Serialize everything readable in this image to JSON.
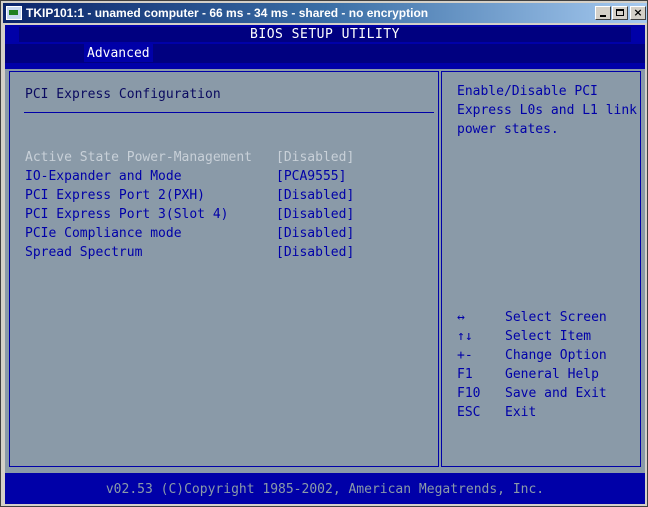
{
  "window": {
    "title": "TKIP101:1 - unamed computer - 66 ms - 34 ms - shared - no encryption",
    "buttons": {
      "minimize": "",
      "maximize": "",
      "close": "×"
    }
  },
  "bios": {
    "title": "BIOS SETUP UTILITY",
    "active_tab": "Advanced",
    "section_title": "PCI Express Configuration",
    "items": [
      {
        "label": "Active State Power-Management",
        "value": "[Disabled]",
        "state": "disabled"
      },
      {
        "label": "IO-Expander and Mode",
        "value": "[PCA9555]",
        "state": "normal"
      },
      {
        "label": "PCI Express Port 2(PXH)",
        "value": "[Disabled]",
        "state": "normal"
      },
      {
        "label": "PCI Express Port 3(Slot 4)",
        "value": "[Disabled]",
        "state": "normal"
      },
      {
        "label": "PCIe Compliance mode",
        "value": "[Disabled]",
        "state": "normal"
      },
      {
        "label": "Spread Spectrum",
        "value": "[Disabled]",
        "state": "normal"
      }
    ],
    "help_text": "Enable/Disable PCI Express L0s and L1 link power states.",
    "keys": [
      {
        "key": "↔",
        "desc": "Select Screen"
      },
      {
        "key": "↑↓",
        "desc": "Select Item"
      },
      {
        "key": "+-",
        "desc": "Change Option"
      },
      {
        "key": "F1",
        "desc": "General Help"
      },
      {
        "key": "F10",
        "desc": "Save and Exit"
      },
      {
        "key": "ESC",
        "desc": "Exit"
      }
    ],
    "footer": "v02.53 (C)Copyright 1985-2002, American Megatrends, Inc."
  }
}
